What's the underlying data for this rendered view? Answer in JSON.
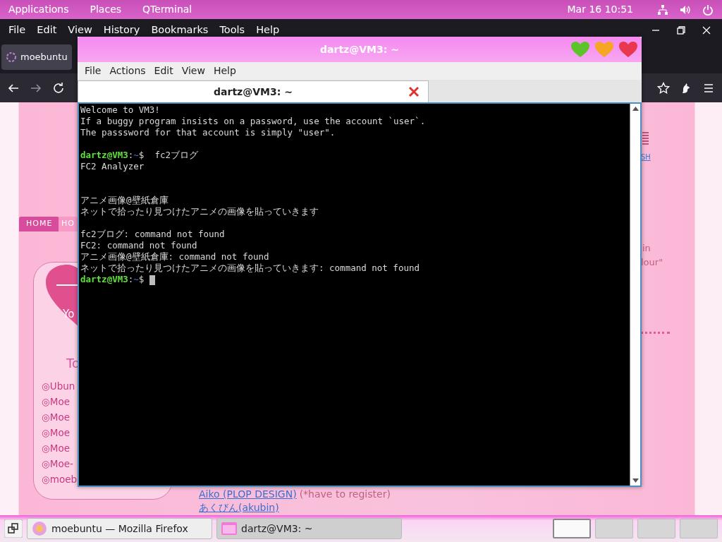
{
  "top_panel": {
    "menus": [
      "Applications",
      "Places",
      "QTerminal"
    ],
    "clock": "Mar 16  10:51"
  },
  "browser": {
    "menus": [
      "File",
      "Edit",
      "View",
      "History",
      "Bookmarks",
      "Tools",
      "Help"
    ],
    "tab": {
      "label": "moebuntu",
      "selected": true
    },
    "page": {
      "nav": [
        {
          "label": "HOME",
          "selected": true
        },
        {
          "label": "HO",
          "selected": false
        }
      ],
      "heart_texts": [
        "Yo"
      ],
      "sidebar_heading": "To",
      "sidebar_links": [
        "◎Ubun",
        "◎Moe",
        "◎Moe",
        "◎Moe",
        "◎Moe",
        "◎Moe-",
        "◎moeb"
      ],
      "right_link": "SH",
      "right_text": [
        "in",
        "lour\""
      ],
      "links": [
        {
          "text": "Aiko (PLOP DESIGN)",
          "note": "(*have to register)"
        },
        {
          "text": "あくびん(akubin)"
        }
      ]
    }
  },
  "terminal": {
    "title": "dartz@VM3: ~",
    "buttons": [
      {
        "color": "#5cc42a"
      },
      {
        "color": "#f5a623"
      },
      {
        "color": "#e8384f"
      }
    ],
    "menus": [
      "File",
      "Actions",
      "Edit",
      "View",
      "Help"
    ],
    "tabs": [
      {
        "label": "dartz@VM3: ~",
        "selected": true
      }
    ],
    "lines": [
      {
        "kind": "text",
        "text": "Welcome to VM3!"
      },
      {
        "kind": "text",
        "text": "If a buggy program insists on a password, use the account `user`."
      },
      {
        "kind": "text",
        "text": "The passsword for that account is simply \"user\"."
      },
      {
        "kind": "blank"
      },
      {
        "kind": "prompt",
        "user": "dartz@VM3",
        "sep": ":",
        "path": "~",
        "symbol": "$",
        "command": "fc2ブログ",
        "cursor": false
      },
      {
        "kind": "text",
        "text": "FC2 Analyzer"
      },
      {
        "kind": "blank"
      },
      {
        "kind": "blank"
      },
      {
        "kind": "text",
        "text": "アニメ画像@壁紙倉庫"
      },
      {
        "kind": "text",
        "text": "ネットで拾ったり見つけたアニメの画像を貼っていきます"
      },
      {
        "kind": "blank"
      },
      {
        "kind": "text",
        "text": "fc2ブログ: command not found"
      },
      {
        "kind": "text",
        "text": "FC2: command not found"
      },
      {
        "kind": "text",
        "text": "アニメ画像@壁紙倉庫: command not found"
      },
      {
        "kind": "text",
        "text": "ネットで拾ったり見つけたアニメの画像を貼っていきます: command not found"
      },
      {
        "kind": "prompt",
        "user": "dartz@VM3",
        "sep": ":",
        "path": "~",
        "symbol": "$",
        "cursor": true
      }
    ]
  },
  "taskbar": {
    "tasks": [
      {
        "label": "moebuntu — Mozilla Firefox",
        "selected": false
      },
      {
        "label": "dartz@VM3: ~",
        "selected": true
      }
    ],
    "workspaces": [
      {
        "selected": true
      },
      {
        "selected": false
      },
      {
        "selected": false
      },
      {
        "selected": false
      }
    ]
  }
}
